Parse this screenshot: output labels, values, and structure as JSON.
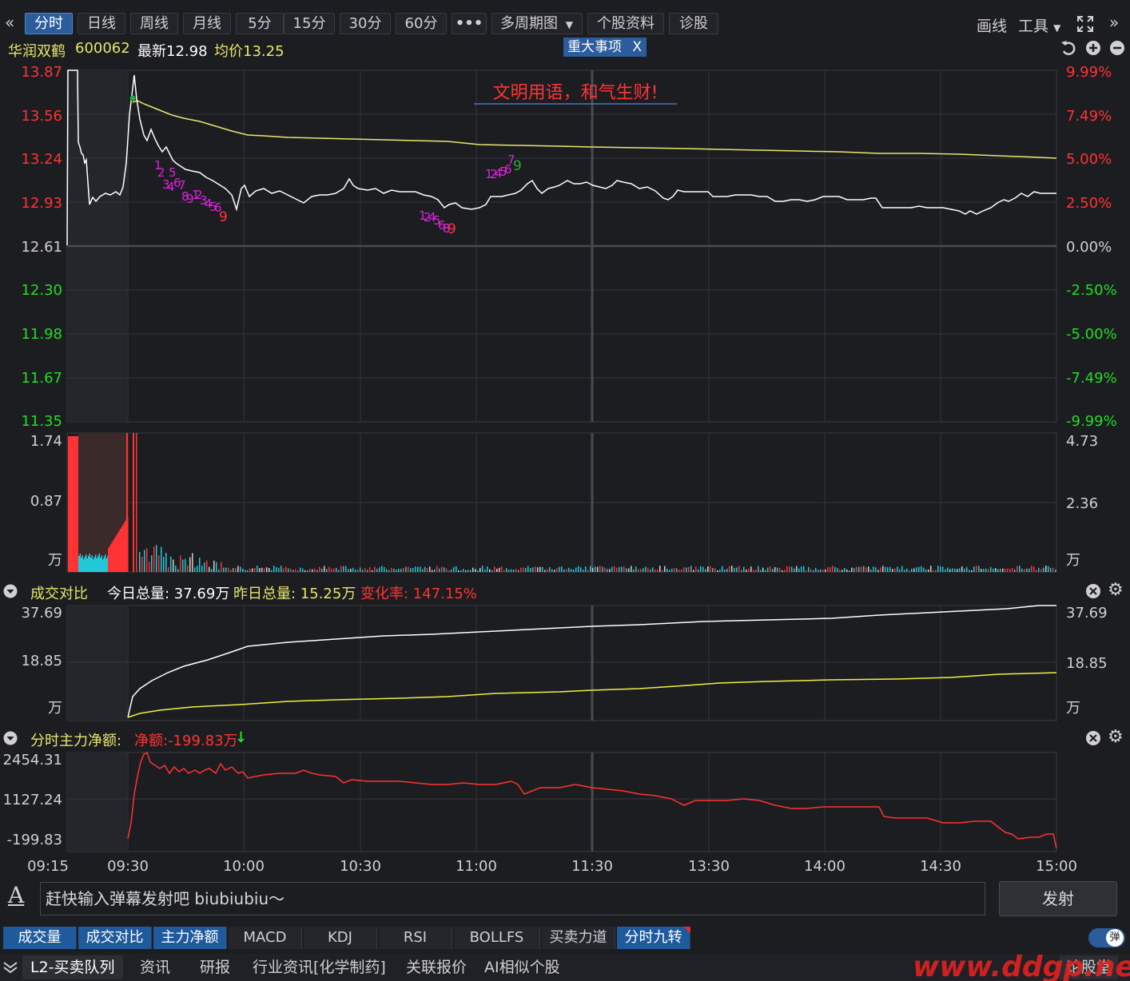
{
  "toolbar": {
    "back_icon": "double-chevron-left-icon",
    "periods": [
      "分时",
      "日线",
      "周线",
      "月线",
      "5分",
      "15分",
      "30分",
      "60分"
    ],
    "more_label": "•••",
    "multi_period_label": "多周期图",
    "stock_info_label": "个股资料",
    "diagnose_label": "诊股",
    "draw_label": "画线",
    "tools_label": "工具"
  },
  "info": {
    "stock_name": "华润双鹤",
    "stock_code": "600062",
    "latest_label": "最新12.98",
    "avg_label": "均价13.25",
    "event_label": "重大事项",
    "event_close": "X"
  },
  "price_chart": {
    "banner": "文明用语，和气生财!",
    "left_ticks": [
      "13.87",
      "13.56",
      "13.24",
      "12.93",
      "12.61",
      "12.30",
      "11.98",
      "11.67",
      "11.35"
    ],
    "right_ticks": [
      "9.99%",
      "7.49%",
      "5.00%",
      "2.50%",
      "0.00%",
      "-2.50%",
      "-5.00%",
      "-7.49%",
      "-9.99%"
    ],
    "price_color": "#ffffff",
    "avg_color": "#e8e86a",
    "up_color": "#ff3333",
    "down_color": "#22dd22"
  },
  "volume_chart": {
    "left_ticks": [
      "1.74",
      "0.87",
      "万"
    ],
    "right_ticks": [
      "4.73",
      "2.36",
      "万"
    ]
  },
  "compare_panel": {
    "title": "成交对比",
    "today_label": "今日总量: 37.69万",
    "yesterday_label": "昨日总量: 15.25万",
    "change_label": "变化率: 147.15%",
    "left_ticks": [
      "37.69",
      "18.85",
      "万"
    ],
    "right_ticks": [
      "37.69",
      "18.85",
      "万"
    ]
  },
  "netflow_panel": {
    "title": "分时主力净额:",
    "net_label": "净额:-199.83万",
    "left_ticks": [
      "2454.31",
      "1127.24",
      "-199.83"
    ]
  },
  "time_axis": [
    "09:15",
    "09:30",
    "10:00",
    "10:30",
    "11:00",
    "11:30",
    "13:30",
    "14:00",
    "14:30",
    "15:00"
  ],
  "danmu": {
    "icon": "font-a-icon",
    "placeholder": "赶快输入弹幕发射吧 biubiubiu～",
    "fire_label": "发射",
    "toggle_label": "弹"
  },
  "indicator_tabs": [
    "成交量",
    "成交对比",
    "主力净额",
    "MACD",
    "KDJ",
    "RSI",
    "BOLLFS",
    "买卖力道",
    "分时九转"
  ],
  "bottom_tabs": [
    "L2-买卖队列",
    "资讯",
    "研报",
    "行业资讯[化学制药]",
    "关联报价",
    "AI相似个股",
    "论股堂"
  ],
  "watermark": "www.ddgp.net"
}
